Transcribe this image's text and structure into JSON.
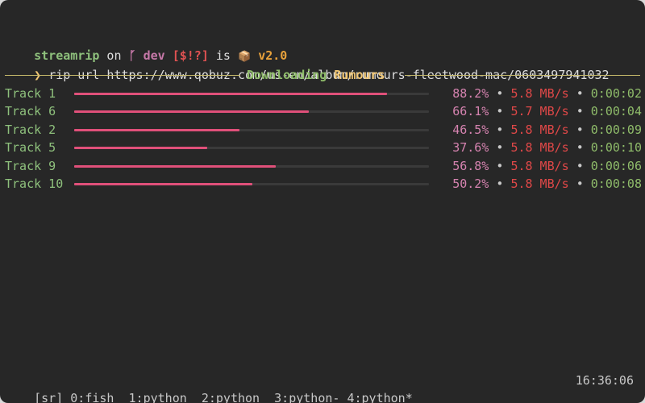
{
  "prompt": {
    "dir": "streamrip",
    "on": " on ",
    "branch_icon": "ᚵ",
    "branch": "dev",
    "status": "[$!?]",
    "is": " is ",
    "package_icon": "📦",
    "version": "v2.0"
  },
  "command": {
    "chevron": "❯",
    "text": "rip url https://www.qobuz.com/us-en/album/rumours-fleetwood-mac/0603497941032"
  },
  "download": {
    "label": "Downloading",
    "album": "Rumours"
  },
  "tracks": [
    {
      "name": "Track 1",
      "progress": 0.882,
      "percent": "88.2%",
      "rate": "5.8 MB/s",
      "eta": "0:00:02"
    },
    {
      "name": "Track 6",
      "progress": 0.661,
      "percent": "66.1%",
      "rate": "5.7 MB/s",
      "eta": "0:00:04"
    },
    {
      "name": "Track 2",
      "progress": 0.465,
      "percent": "46.5%",
      "rate": "5.8 MB/s",
      "eta": "0:00:09"
    },
    {
      "name": "Track 5",
      "progress": 0.376,
      "percent": "37.6%",
      "rate": "5.8 MB/s",
      "eta": "0:00:10"
    },
    {
      "name": "Track 9",
      "progress": 0.568,
      "percent": "56.8%",
      "rate": "5.8 MB/s",
      "eta": "0:00:06"
    },
    {
      "name": "Track 10",
      "progress": 0.502,
      "percent": "50.2%",
      "rate": "5.8 MB/s",
      "eta": "0:00:08"
    }
  ],
  "separator": "•",
  "tmux": {
    "session": "[sr]",
    "windows": [
      "0:fish",
      "1:python",
      "2:python",
      "3:python-",
      "4:python*"
    ],
    "clock": "16:36:06"
  },
  "colors": {
    "background": "#272727",
    "bar_fill": "#e0507a",
    "bar_track": "#3a3a3a",
    "track_name": "#8ec07c",
    "percent": "#d683b0",
    "rate": "#e04848",
    "eta": "#8fbc6a",
    "rule": "#c6b96a"
  }
}
